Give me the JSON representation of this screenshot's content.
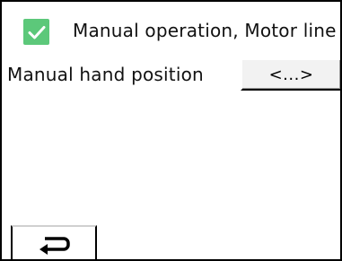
{
  "header": {
    "checkbox_checked": true,
    "checkbox_color": "#5cc87a",
    "title": "Manual operation, Motor line"
  },
  "manual_hand_position": {
    "label": "Manual hand position",
    "value": "<...>"
  },
  "footer": {
    "back_icon": "return-arrow-icon"
  }
}
